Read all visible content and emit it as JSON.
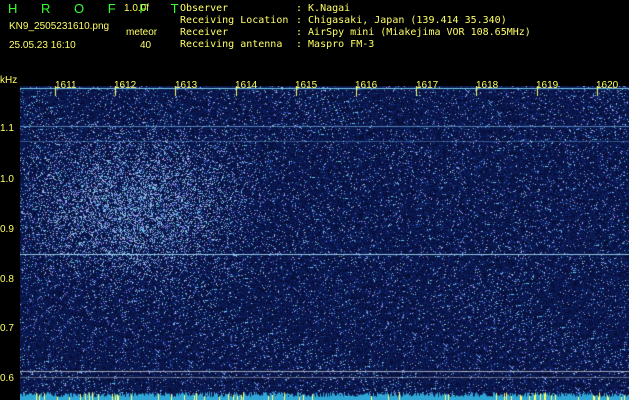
{
  "header": {
    "title": "H R O F F T",
    "version": "1.0.0f",
    "filename": "KN9_2505231610.png",
    "timestamp": "25.05.23 16:10",
    "meteor_label": "meteor",
    "meteor_count": "40",
    "info": [
      {
        "key": "Observer",
        "value": ": K.Nagai"
      },
      {
        "key": "Receiving Location",
        "value": ": Chigasaki, Japan (139.414 35.340)"
      },
      {
        "key": "Receiver",
        "value": ": AirSpy mini (Miakejima VOR 108.65MHz)"
      },
      {
        "key": "Receiving antenna",
        "value": ": Maspro FM-3"
      }
    ]
  },
  "axes": {
    "y_unit": "kHz",
    "y_ticks": [
      "1.1",
      "1.0",
      "0.9",
      "0.8",
      "0.7",
      "0.6"
    ],
    "x_ticks": [
      "1611",
      "1612",
      "1613",
      "1614",
      "1615",
      "1616",
      "1617",
      "1618",
      "1619",
      "1620"
    ]
  },
  "colors": {
    "background": "#000000",
    "noise": "#1a2a9a",
    "signal": "#8fd6ff",
    "text": "#ffff66",
    "title": "#33ff33"
  }
}
